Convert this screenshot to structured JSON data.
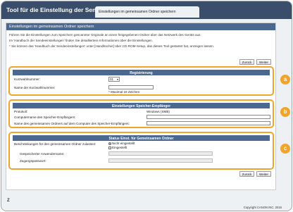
{
  "header": {
    "app_title": "Tool für die Einstellung der Sendefunktion",
    "tab_label": "Einstellungen im gemeinsamen Ordner speichern"
  },
  "page": {
    "subheading": "Einstellungen im gemeinsamen Ordner speichern",
    "info_lines": [
      "Führen Sie die Einstellungen zum Speichern gescannter Originale an einen freigegebenen Ordner über das Netzwerk des Geräts aus.",
      "Im 'Handbuch der Sendeeinstellungen' finden Sie detailliertere Informationen über die Einstellungen.",
      "* Sie können das 'Handbuch der Sendeeinstellungen' unter [Handbücher] über CD-ROM-Setup, das dieses Tool gestartet hat, anzeigen lassen."
    ],
    "back_label": "Zurück",
    "next_label": "Weiter"
  },
  "registration": {
    "title": "Registrierung",
    "number_label": "Kurzwahlnummer:",
    "number_value": "01",
    "name_label": "Name der Kurzwahlnummer:",
    "name_value": "",
    "name_hint": "* Maximal 16 Zeichen"
  },
  "destination": {
    "title": "Einstellungen Speicher-Empfänger",
    "protocol_label": "Protokoll:",
    "protocol_value": "Windows (SMB)",
    "computer_label": "Computername des Speicher-Empfängers:",
    "folder_label": "Name des gemeinsamen Ordners auf dem Computer des Speicher-Empfängers:"
  },
  "status": {
    "title": "Status Einst. für Gemeinsamen Ordner",
    "restriction_label": "Beschränkungen für den gemeinsamen Ordner zulassen:",
    "option_off": "Nicht eingestellt",
    "option_on": "Eingestellt",
    "username_label": "Gespeicherter Anwendername:",
    "password_label": "Zugangspasswort:"
  },
  "callouts": [
    "a",
    "b",
    "c"
  ],
  "footer": {
    "copyright": "Copyright CANON INC. 2016"
  },
  "colors": {
    "header_bg": "#3a4e6c",
    "section_title_bg": "#4a6890",
    "callout_accent": "#f0a42c"
  }
}
